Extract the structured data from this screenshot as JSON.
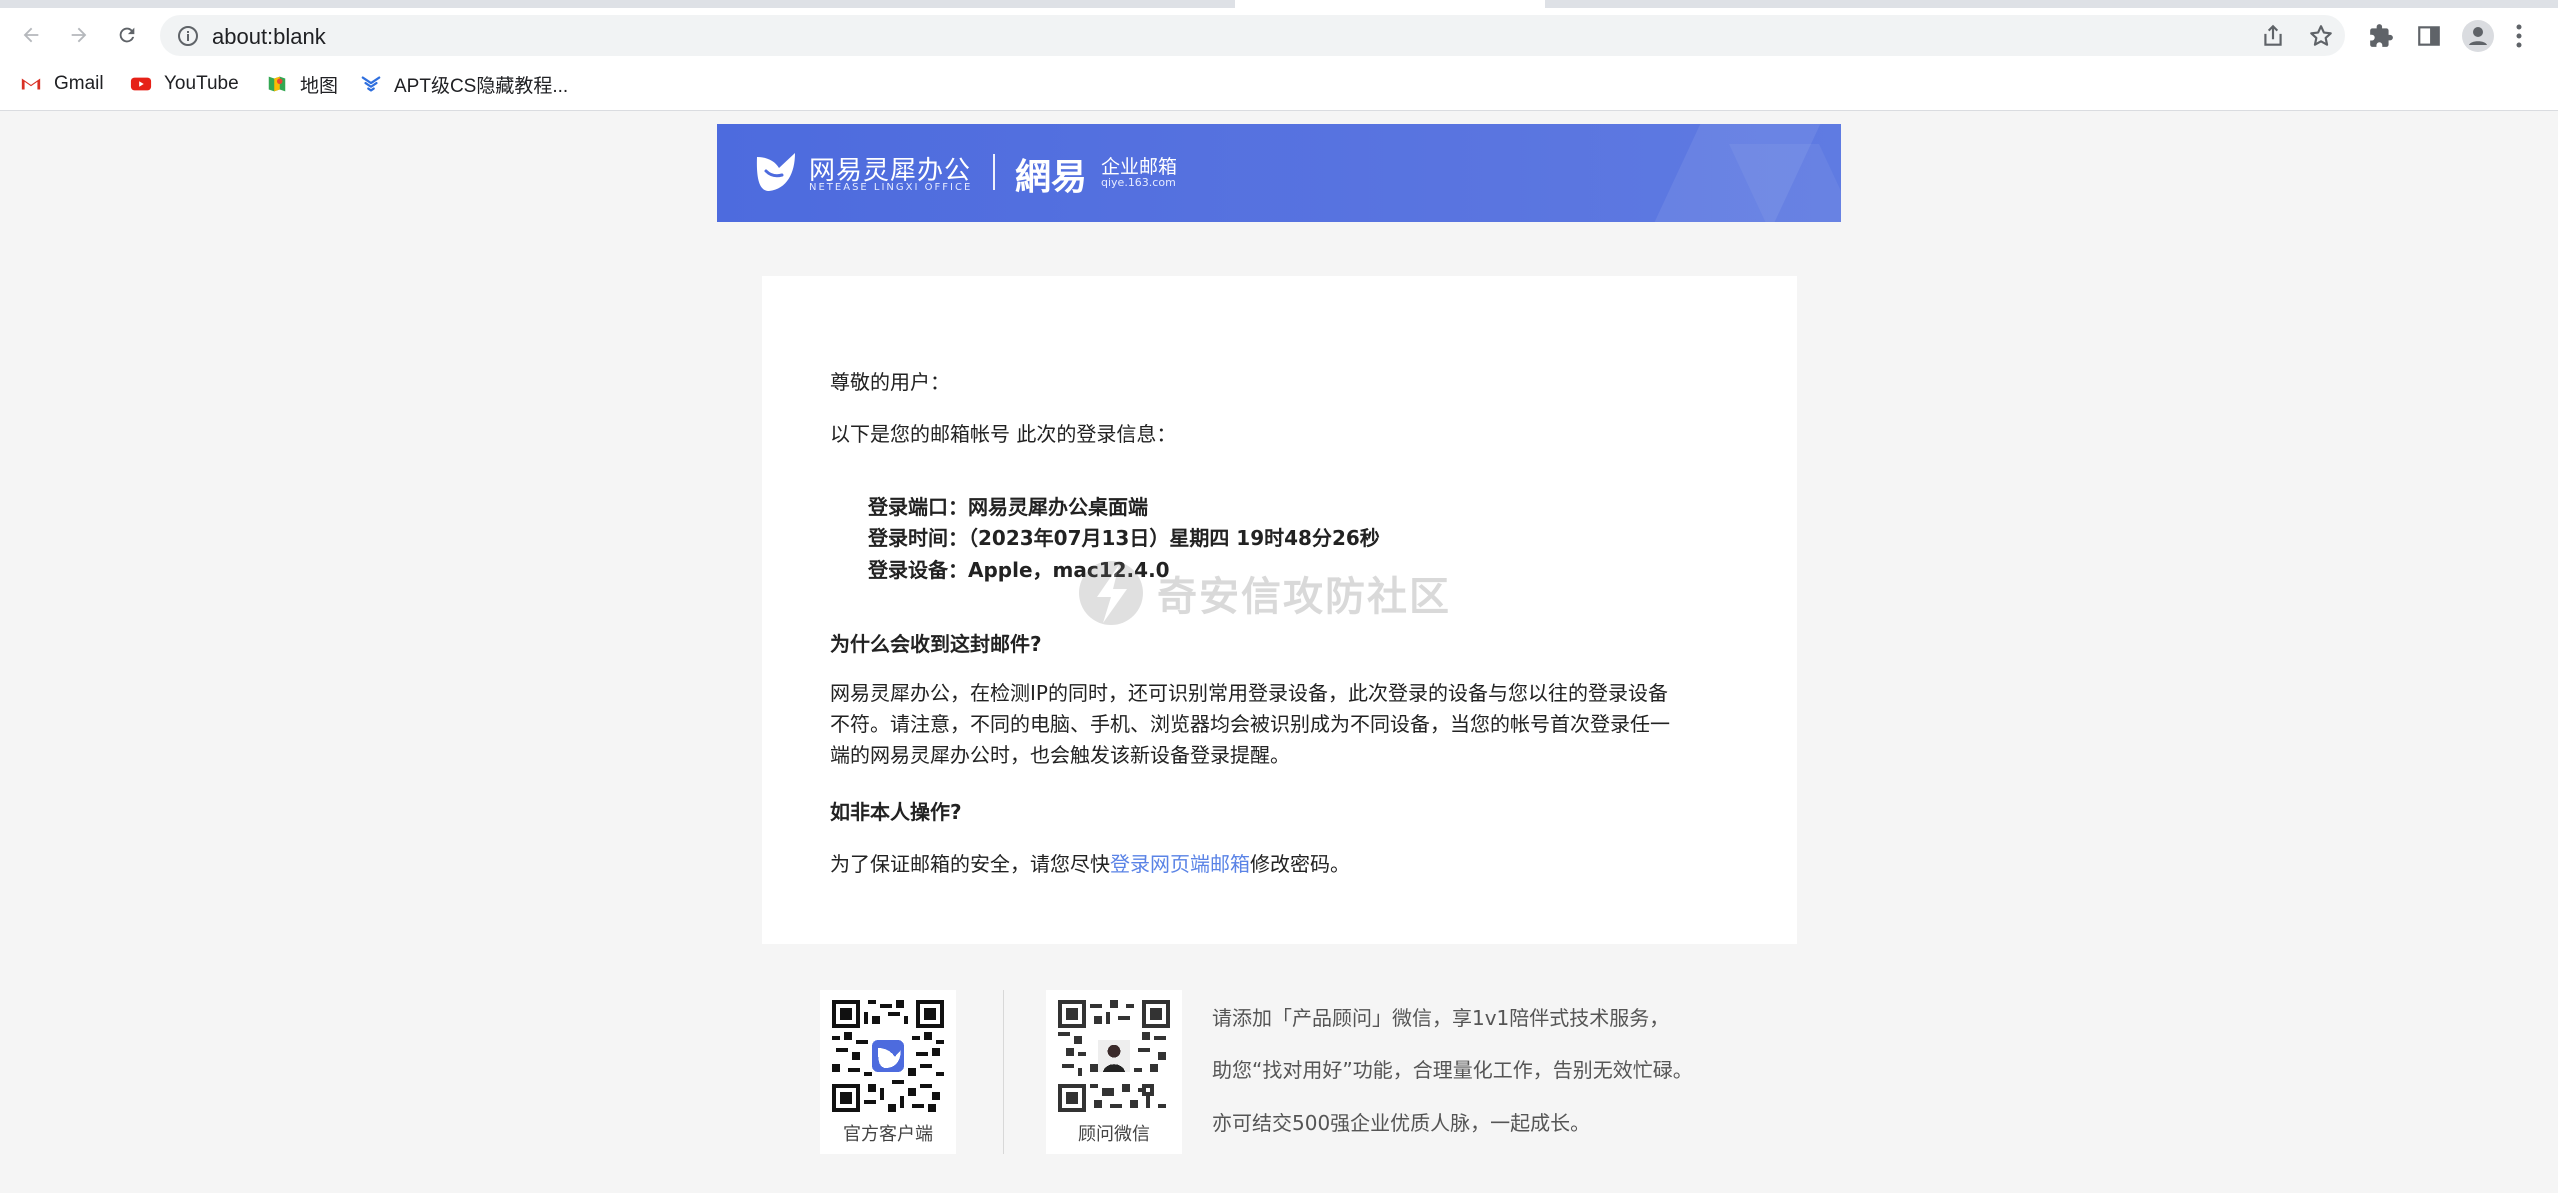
{
  "browser": {
    "url": "about:blank",
    "bookmarks": [
      {
        "label": "Gmail",
        "icon": "gmail-icon"
      },
      {
        "label": "YouTube",
        "icon": "youtube-icon"
      },
      {
        "label": "地图",
        "icon": "maps-icon"
      },
      {
        "label": "APT级CS隐藏教程...",
        "icon": "bookmark-site-icon"
      }
    ]
  },
  "banner": {
    "brand": "网易灵犀办公",
    "brand_sub": "NETEASE LINGXI OFFICE",
    "netease": "網易",
    "qiye": "企业邮箱",
    "qiye_url": "qiye.163.com",
    "color": "#4d6bde"
  },
  "email": {
    "greeting": "尊敬的用户：",
    "intro": "以下是您的邮箱帐号 此次的登录信息：",
    "login_port": "登录端口：网易灵犀办公桌面端",
    "login_time": "登录时间：（2023年07月13日）星期四 19时48分26秒",
    "login_device": "登录设备：Apple，mac12.4.0",
    "why_heading": "为什么会收到这封邮件?",
    "why_line1": "网易灵犀办公，在检测IP的同时，还可识别常用登录设备，此次登录的设备与您以往的登录设备",
    "why_line2": "不符。请注意，不同的电脑、手机、浏览器均会被识别成为不同设备，当您的帐号首次登录任一",
    "why_line3": "端的网易灵犀办公时，也会触发该新设备登录提醒。",
    "notme_heading": "如非本人操作?",
    "notme_prefix": "为了保证邮箱的安全，请您尽快",
    "notme_link": "登录网页端邮箱",
    "notme_suffix": "修改密码。",
    "link_color": "#5a83e6"
  },
  "watermark": {
    "text": "奇安信攻防社区"
  },
  "footer": {
    "qr1_caption": "官方客户端",
    "qr2_caption": "顾问微信",
    "line1": "请添加「产品顾问」微信，享1v1陪伴式技术服务，",
    "line2": "助您“找对用好”功能，合理量化工作，告别无效忙碌。",
    "line3": "亦可结交500强企业优质人脉，一起成长。"
  }
}
